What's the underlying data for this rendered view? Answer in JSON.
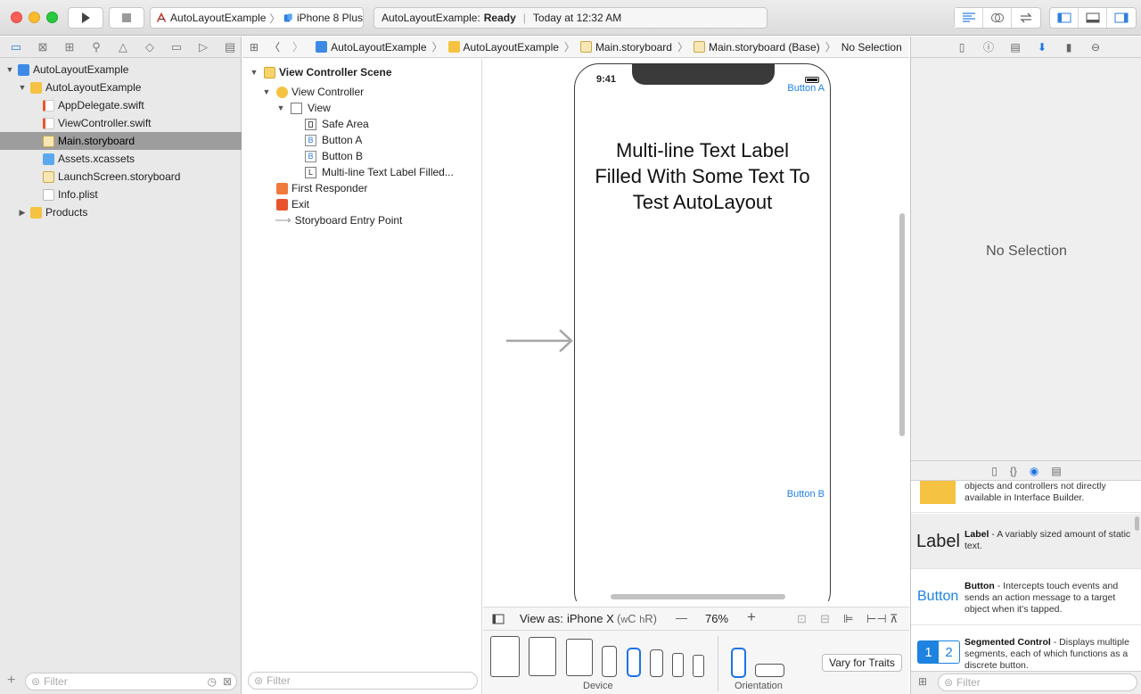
{
  "toolbar": {
    "scheme_project": "AutoLayoutExample",
    "scheme_device": "iPhone 8 Plus",
    "activity_project": "AutoLayoutExample:",
    "activity_status": "Ready",
    "activity_time": "Today at 12:32 AM"
  },
  "navigator": {
    "items": [
      {
        "label": "AutoLayoutExample"
      },
      {
        "label": "AutoLayoutExample"
      },
      {
        "label": "AppDelegate.swift"
      },
      {
        "label": "ViewController.swift"
      },
      {
        "label": "Main.storyboard"
      },
      {
        "label": "Assets.xcassets"
      },
      {
        "label": "LaunchScreen.storyboard"
      },
      {
        "label": "Info.plist"
      },
      {
        "label": "Products"
      }
    ],
    "filter_placeholder": "Filter"
  },
  "jumpbar": {
    "crumbs": [
      "AutoLayoutExample",
      "AutoLayoutExample",
      "Main.storyboard",
      "Main.storyboard (Base)",
      "No Selection"
    ]
  },
  "outline": {
    "items": [
      {
        "label": "View Controller Scene"
      },
      {
        "label": "View Controller"
      },
      {
        "label": "View"
      },
      {
        "label": "Safe Area",
        "glyph": ""
      },
      {
        "label": "Button A",
        "glyph": "B"
      },
      {
        "label": "Button B",
        "glyph": "B"
      },
      {
        "label": "Multi-line Text Label Filled...",
        "glyph": "L"
      },
      {
        "label": "First Responder"
      },
      {
        "label": "Exit"
      },
      {
        "label": "Storyboard Entry Point"
      }
    ],
    "filter_placeholder": "Filter"
  },
  "canvas": {
    "status_time": "9:41",
    "button_a": "Button A",
    "button_b": "Button B",
    "label_lines": [
      "Multi-line Text Label",
      "Filled With Some Text To",
      "Test AutoLayout"
    ]
  },
  "viewas": {
    "prefix": "View as:",
    "device": "iPhone X",
    "w": "w",
    "wc": "C",
    "h": "h",
    "hr": "R",
    "minus": "—",
    "zoom": "76%",
    "plus": "+"
  },
  "devicebar": {
    "device_label": "Device",
    "orientation_label": "Orientation",
    "vary_button": "Vary for Traits"
  },
  "inspector": {
    "no_selection": "No Selection"
  },
  "library": {
    "partial_text": "objects and controllers not directly available in Interface Builder.",
    "label_preview": "Label",
    "label_title": "Label",
    "label_desc": " - A variably sized amount of static text.",
    "button_preview": "Button",
    "button_title": "Button",
    "button_desc": " - Intercepts touch events and sends an action message to a target object when it's tapped.",
    "seg_1": "1",
    "seg_2": "2",
    "seg_title": "Segmented Control",
    "seg_desc": " - Displays multiple segments, each of which functions as a discrete button.",
    "filter_placeholder": "Filter"
  },
  "colors": {
    "accent": "#1a73e8",
    "ios_blue": "#1d82e0",
    "selection": "#9d9d9d"
  }
}
